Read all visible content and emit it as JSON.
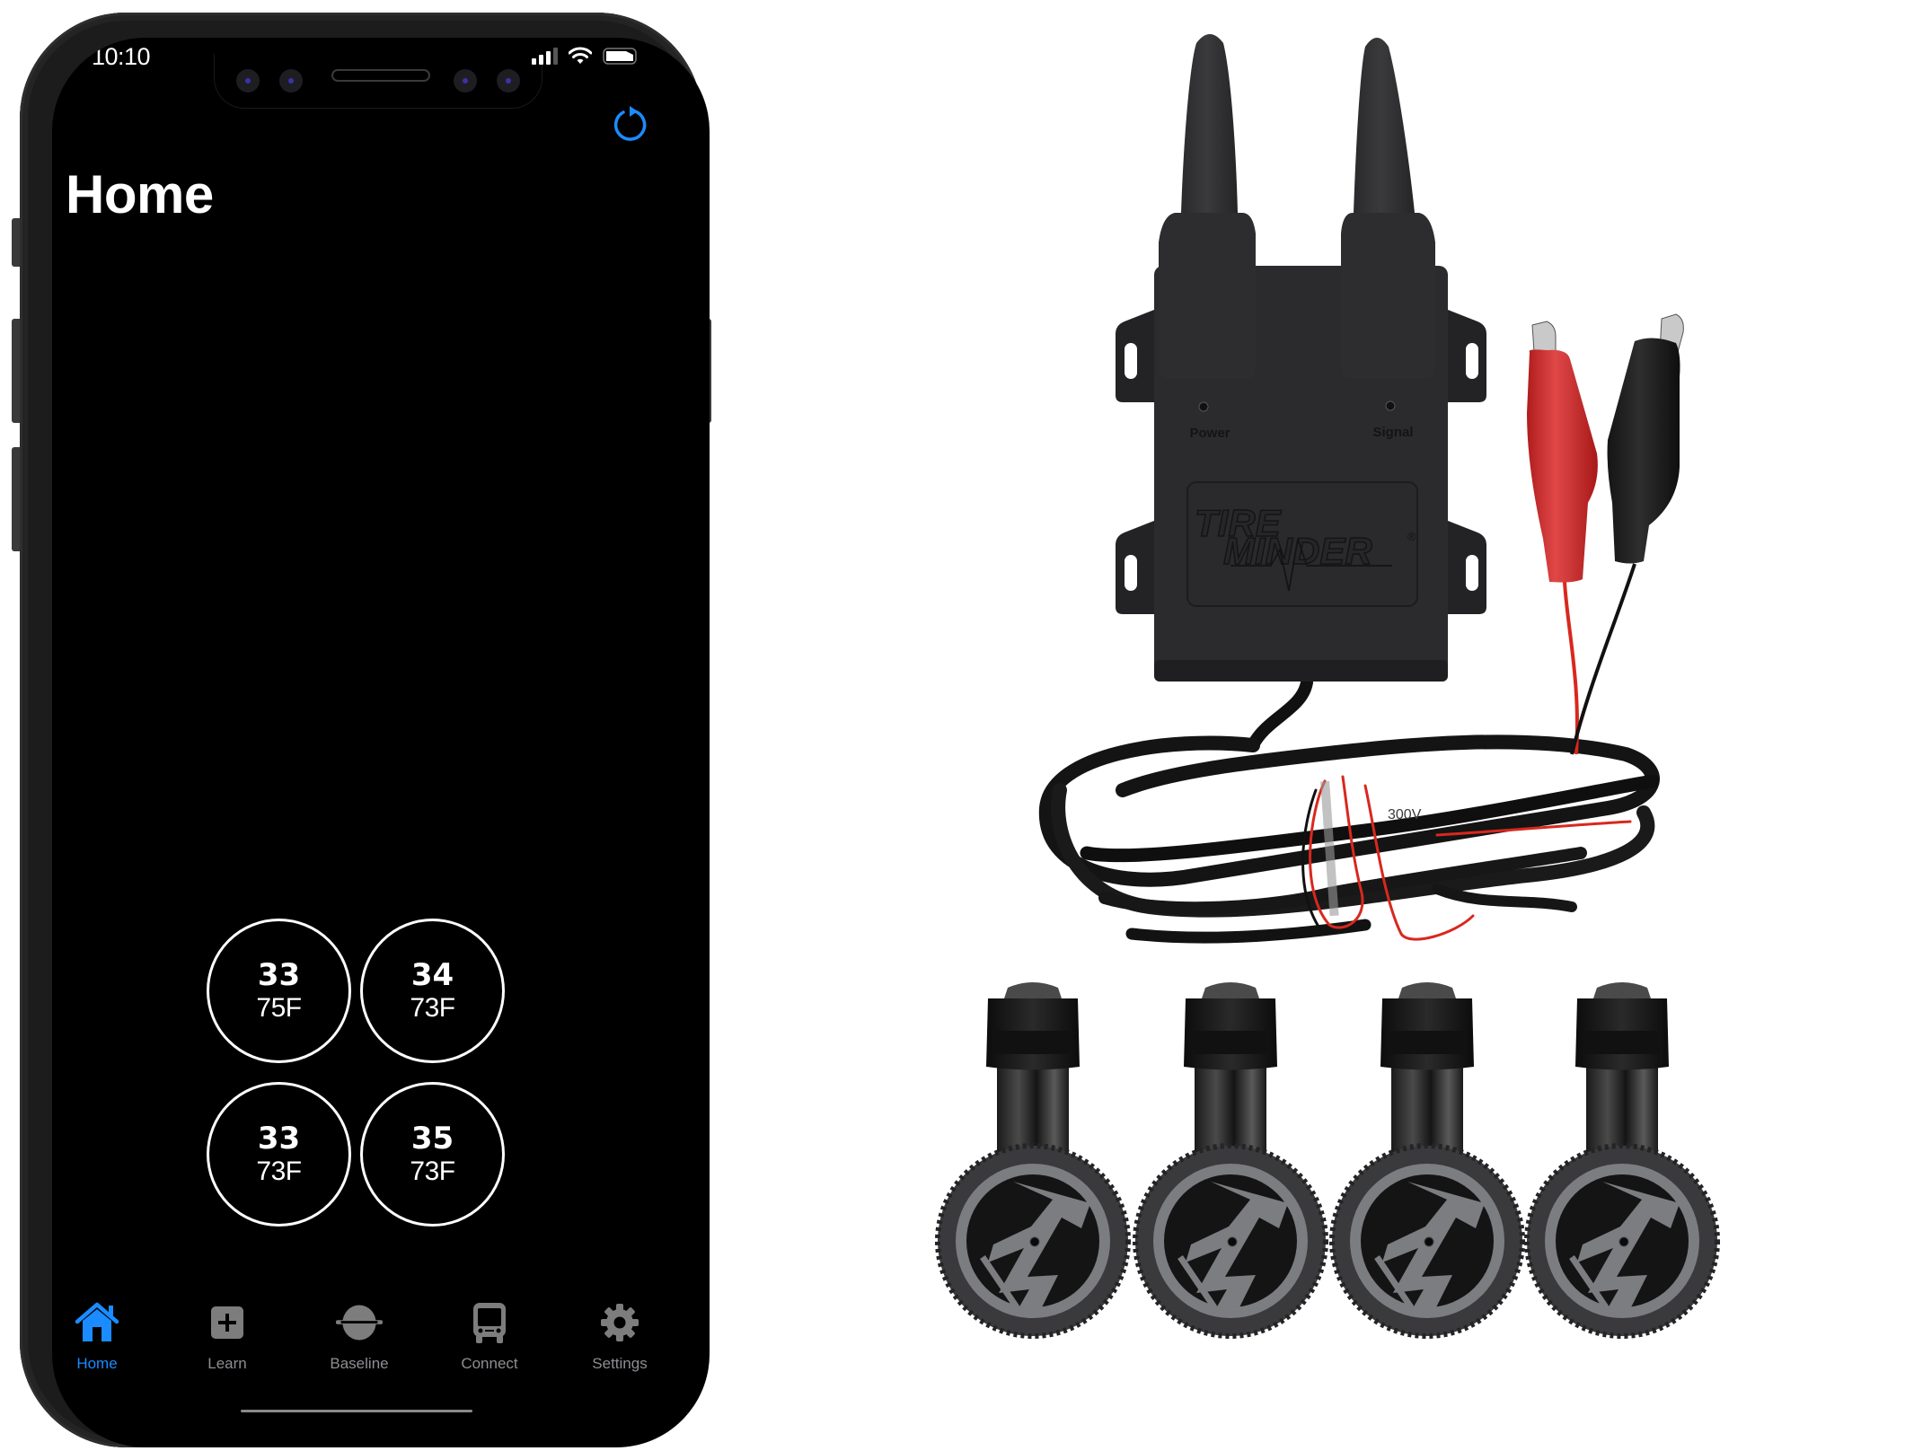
{
  "status_bar": {
    "time": "10:10",
    "icons": [
      "cellular-signal-icon",
      "wifi-icon",
      "battery-icon"
    ]
  },
  "nav": {
    "title": "Home",
    "refresh_icon": "refresh-icon"
  },
  "colors": {
    "accent": "#1a8cff",
    "inactive_tab": "#8e8e93",
    "screen_bg": "#000000",
    "tire_ring": "#ffffff"
  },
  "tires": [
    {
      "position": "front-left",
      "pressure": "33",
      "temperature": "75F"
    },
    {
      "position": "front-right",
      "pressure": "34",
      "temperature": "73F"
    },
    {
      "position": "rear-left",
      "pressure": "33",
      "temperature": "73F"
    },
    {
      "position": "rear-right",
      "pressure": "35",
      "temperature": "73F"
    }
  ],
  "tabbar": {
    "items": [
      {
        "label": "Home",
        "icon": "house-icon",
        "active": true
      },
      {
        "label": "Learn",
        "icon": "plus-square-icon",
        "active": false
      },
      {
        "label": "Baseline",
        "icon": "baseline-icon",
        "active": false
      },
      {
        "label": "Connect",
        "icon": "bus-icon",
        "active": false
      },
      {
        "label": "Settings",
        "icon": "gear-icon",
        "active": false
      }
    ]
  },
  "hardware": {
    "repeater": {
      "brand_line1": "TIRE",
      "brand_line2": "MINDER",
      "registered": "®",
      "led_labels": [
        "Power",
        "Signal"
      ],
      "cable_print": "300V"
    },
    "sensor_count": 4
  }
}
